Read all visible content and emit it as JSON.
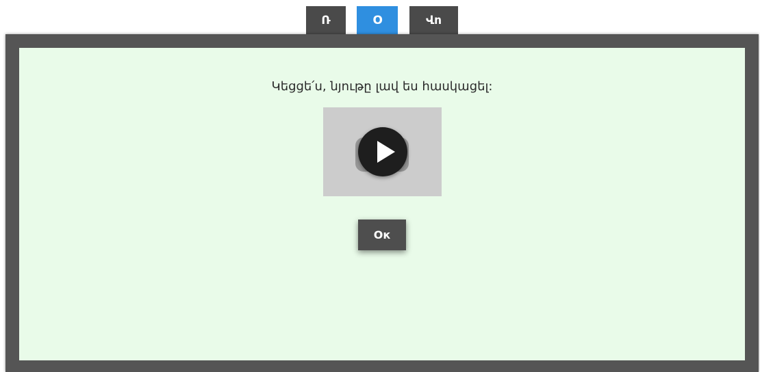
{
  "tabs": [
    {
      "label": "Ռ",
      "active": false
    },
    {
      "label": "Օ",
      "active": true
    },
    {
      "label": "Վո",
      "active": false
    }
  ],
  "panel": {
    "message": "Կեցցե՛ս, նյութը լավ ես հասկացել:",
    "video_icon": "play-icon",
    "ok_label": "Ок"
  },
  "colors": {
    "tab_inactive": "#4a4a4a",
    "tab_active": "#2f8fe0",
    "frame": "#555555",
    "panel_bg": "#e9fbe9",
    "button_bg": "#4e4e4e"
  }
}
